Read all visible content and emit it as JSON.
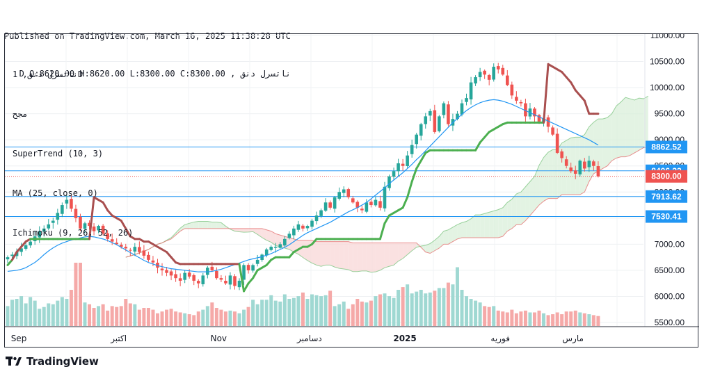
{
  "header": {
    "published_line": "Published on TradingView.com, March 16, 2025 11:38:28 UTC",
    "ohlc_line": "ناتسرل دنق , D O:8620.00 H:8620.00 L:8300.00 C:8300.00"
  },
  "legend": {
    "symbol": "ناتسرل دنق, 1D",
    "exchange": "مجح",
    "supertrend": "SuperTrend (10, 3)",
    "ma": "MA (25, close, 0)",
    "ichimoku": "Ichimoku (9, 26, 52, 26)"
  },
  "footer": {
    "brand": "TradingView"
  },
  "colors": {
    "up": "#26a69a",
    "down": "#ef5350",
    "supertrend_up": "#4caf50",
    "supertrend_down": "#a94f4f",
    "ma": "#2196f3",
    "cloud_bull": "#d7eed7",
    "cloud_bear": "#f8d4d4",
    "hline": "#2196f3",
    "label_bg": "#2196f3",
    "last_price_bg": "#ef5350"
  },
  "chart_data": {
    "type": "candlestick",
    "title": "",
    "ylim": [
      5500,
      11000
    ],
    "y_ticks": [
      "11000.00",
      "10500.00",
      "10000.00",
      "9500.00",
      "9000.00",
      "8500.00",
      "8000.00",
      "7500.00",
      "7000.00",
      "6500.00",
      "6000.00",
      "5500.00"
    ],
    "x_labels": [
      {
        "text": "Sep",
        "index": 0
      },
      {
        "text": "اکتبر",
        "index": 22
      },
      {
        "text": "Nov",
        "index": 44
      },
      {
        "text": "دسامبر",
        "index": 64
      },
      {
        "text": "2025",
        "index": 85
      },
      {
        "text": "فوریه",
        "index": 106
      },
      {
        "text": "مارس",
        "index": 122
      }
    ],
    "price_labels": [
      {
        "text": "8862.52",
        "value": 8862.52,
        "type": "hline"
      },
      {
        "text": "8406.32",
        "value": 8406.32,
        "type": "hline"
      },
      {
        "text": "8300.00",
        "value": 8300.0,
        "type": "last"
      },
      {
        "text": "7913.62",
        "value": 7913.62,
        "type": "hline"
      },
      {
        "text": "7530.41",
        "value": 7530.41,
        "type": "hline"
      }
    ],
    "close": [
      6750,
      6800,
      6850,
      6920,
      6980,
      7050,
      7150,
      7250,
      7300,
      7380,
      7450,
      7600,
      7750,
      7850,
      7680,
      7500,
      7300,
      7400,
      7350,
      7250,
      7350,
      7200,
      7100,
      7050,
      7000,
      6950,
      6920,
      6880,
      6950,
      6850,
      6780,
      6700,
      6650,
      6550,
      6500,
      6450,
      6400,
      6350,
      6300,
      6450,
      6380,
      6300,
      6250,
      6400,
      6550,
      6500,
      6350,
      6320,
      6250,
      6400,
      6200,
      6300,
      6600,
      6500,
      6600,
      6700,
      6800,
      6900,
      6950,
      6950,
      7000,
      7100,
      7200,
      7300,
      7380,
      7300,
      7350,
      7450,
      7550,
      7650,
      7800,
      7700,
      7900,
      8000,
      8050,
      7900,
      7800,
      7700,
      7650,
      7800,
      7750,
      7850,
      7700,
      8100,
      8300,
      8400,
      8550,
      8500,
      8700,
      8900,
      9100,
      9300,
      9450,
      9550,
      9150,
      9450,
      9700,
      9300,
      9400,
      9500,
      9700,
      9800,
      10100,
      10200,
      10300,
      10250,
      10150,
      10400,
      10350,
      10250,
      10050,
      9850,
      9750,
      9700,
      9450,
      9600,
      9450,
      9350,
      9400,
      9250,
      9100,
      8750,
      8650,
      8500,
      8400,
      8350,
      8600,
      8450,
      8600,
      8500,
      8300
    ],
    "supertrend": [
      6600,
      6700,
      6850,
      6950,
      7050,
      7100,
      7100,
      7100,
      7100,
      7100,
      7100,
      7100,
      7100,
      7100,
      7100,
      7100,
      7100,
      7100,
      7100,
      7900,
      7850,
      7800,
      7650,
      7550,
      7500,
      7450,
      7300,
      7150,
      7100,
      7100,
      7050,
      7050,
      7000,
      6950,
      6900,
      6850,
      6750,
      6650,
      6620,
      6620,
      6620,
      6620,
      6620,
      6620,
      6620,
      6620,
      6620,
      6620,
      6620,
      6620,
      6620,
      6620,
      6100,
      6250,
      6350,
      6500,
      6550,
      6600,
      6700,
      6750,
      6750,
      6750,
      6750,
      6850,
      6900,
      6950,
      6950,
      7000,
      7100,
      7100,
      7100,
      7100,
      7100,
      7100,
      7100,
      7100,
      7100,
      7100,
      7100,
      7100,
      7100,
      7100,
      7100,
      7400,
      7550,
      7600,
      7650,
      7700,
      7900,
      8200,
      8450,
      8600,
      8750,
      8800,
      8800,
      8800,
      8800,
      8800,
      8800,
      8800,
      8800,
      8800,
      8800,
      8800,
      8950,
      9050,
      9150,
      9200,
      9250,
      9300,
      9330,
      9330,
      9330,
      9330,
      9330,
      9330,
      9330,
      9330,
      9330,
      10450,
      10400,
      10350,
      10300,
      10200,
      10100,
      9950,
      9850,
      9750,
      9500,
      9500,
      9500,
      9500,
      9300,
      9280
    ],
    "ma": [
      6480,
      6490,
      6500,
      6520,
      6550,
      6600,
      6650,
      6720,
      6800,
      6870,
      6930,
      6980,
      7020,
      7050,
      7080,
      7100,
      7120,
      7140,
      7150,
      7140,
      7120,
      7100,
      7070,
      7030,
      6990,
      6940,
      6890,
      6840,
      6790,
      6740,
      6690,
      6650,
      6620,
      6590,
      6570,
      6550,
      6530,
      6520,
      6510,
      6500,
      6490,
      6480,
      6470,
      6470,
      6470,
      6480,
      6500,
      6520,
      6550,
      6580,
      6610,
      6640,
      6670,
      6700,
      6720,
      6740,
      6760,
      6790,
      6820,
      6860,
      6900,
      6940,
      6990,
      7050,
      7110,
      7170,
      7220,
      7260,
      7300,
      7340,
      7380,
      7420,
      7470,
      7520,
      7570,
      7620,
      7660,
      7700,
      7750,
      7800,
      7870,
      7940,
      8010,
      8080,
      8160,
      8230,
      8300,
      8370,
      8450,
      8530,
      8620,
      8700,
      8790,
      8880,
      8970,
      9060,
      9150,
      9240,
      9330,
      9410,
      9490,
      9560,
      9620,
      9670,
      9710,
      9740,
      9760,
      9770,
      9760,
      9740,
      9710,
      9680,
      9640,
      9600,
      9560,
      9520,
      9480,
      9440,
      9400,
      9360,
      9320,
      9280,
      9240,
      9200,
      9160,
      9120,
      9080,
      9040,
      9000,
      8950,
      8900
    ],
    "volume": [
      220,
      290,
      300,
      330,
      250,
      320,
      280,
      190,
      210,
      250,
      240,
      280,
      320,
      300,
      400,
      700,
      700,
      260,
      240,
      200,
      220,
      240,
      170,
      220,
      210,
      220,
      300,
      250,
      240,
      180,
      200,
      200,
      180,
      140,
      160,
      180,
      190,
      160,
      150,
      140,
      130,
      120,
      160,
      180,
      220,
      260,
      200,
      180,
      160,
      170,
      160,
      140,
      180,
      210,
      290,
      240,
      290,
      290,
      340,
      280,
      270,
      350,
      300,
      310,
      330,
      370,
      300,
      350,
      340,
      330,
      340,
      390,
      220,
      240,
      270,
      190,
      240,
      300,
      270,
      260,
      280,
      330,
      350,
      360,
      330,
      310,
      400,
      430,
      460,
      360,
      380,
      400,
      360,
      370,
      390,
      420,
      420,
      480,
      460,
      650,
      400,
      330,
      300,
      280,
      260,
      220,
      210,
      220,
      170,
      160,
      150,
      180,
      140,
      160,
      170,
      150,
      150,
      170,
      140,
      120,
      130,
      150,
      130,
      160,
      160,
      170,
      150,
      140,
      130,
      120,
      110
    ]
  }
}
